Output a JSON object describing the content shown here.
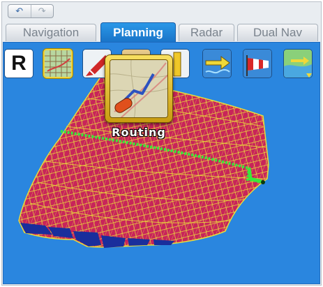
{
  "history": {
    "undo_icon": "undo-arrow",
    "redo_icon": "redo-arrow"
  },
  "tabs": [
    {
      "label": "Navigation",
      "active": false
    },
    {
      "label": "Planning",
      "active": true
    },
    {
      "label": "Radar",
      "active": false
    },
    {
      "label": "Dual Nav",
      "active": false
    }
  ],
  "toolbar": {
    "tools": [
      {
        "icon": "route-r-icon",
        "label": "R",
        "selected": false
      },
      {
        "icon": "chart-grid-icon",
        "selected": true
      },
      {
        "icon": "red-marker-icon",
        "selected": false
      },
      {
        "icon": "routing-icon",
        "selected": false
      },
      {
        "icon": "yellow-bar-icon",
        "selected": false
      },
      {
        "icon": "current-arrow-icon",
        "selected": false
      },
      {
        "icon": "windsock-icon",
        "selected": false
      },
      {
        "icon": "weather-overlay-icon",
        "selected": false
      }
    ]
  },
  "popup": {
    "label": "Routing",
    "icon": "routing-icon"
  },
  "colors": {
    "panel": "#2a86df",
    "active_tab": "#1a74c8",
    "mesh_red": "#c8245a",
    "mesh_yellow": "#e8dc3a",
    "route_green": "#39e83a",
    "highlight": "#f3d43a"
  }
}
